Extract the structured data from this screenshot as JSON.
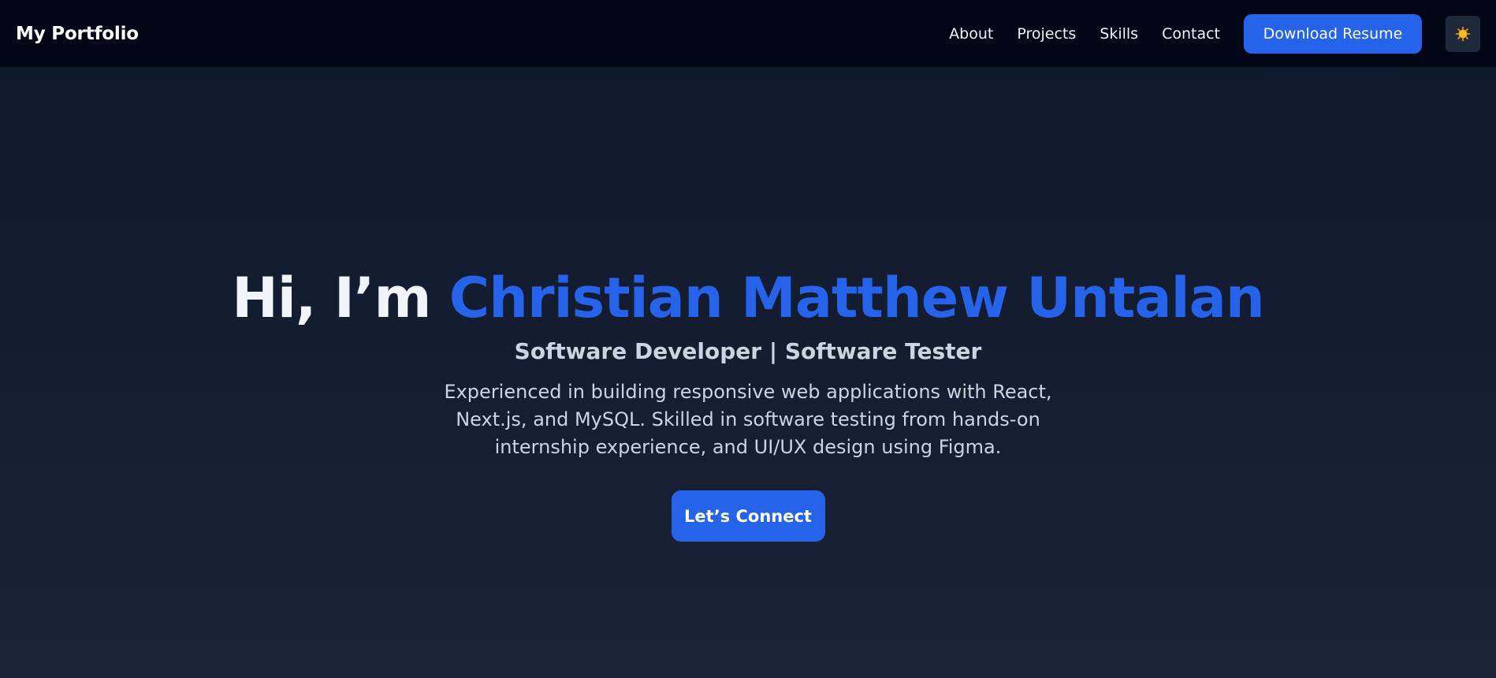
{
  "navbar": {
    "brand": "My Portfolio",
    "links": [
      "About",
      "Projects",
      "Skills",
      "Contact"
    ],
    "resume_button": "Download Resume",
    "theme_toggle_icon": "sun-icon"
  },
  "hero": {
    "greeting": "Hi, I’m ",
    "name": "Christian Matthew Untalan",
    "subtitle": "Software Developer | Software Tester",
    "description": "Experienced in building responsive web applications with React, Next.js, and MySQL. Skilled in software testing from hands-on internship experience, and UI/UX design using Figma.",
    "cta_button": "Let’s Connect"
  },
  "colors": {
    "navbar_bg": "#020617",
    "page_bg": "#0f172a",
    "accent": "#2563eb",
    "sun": "#f59e0b"
  }
}
